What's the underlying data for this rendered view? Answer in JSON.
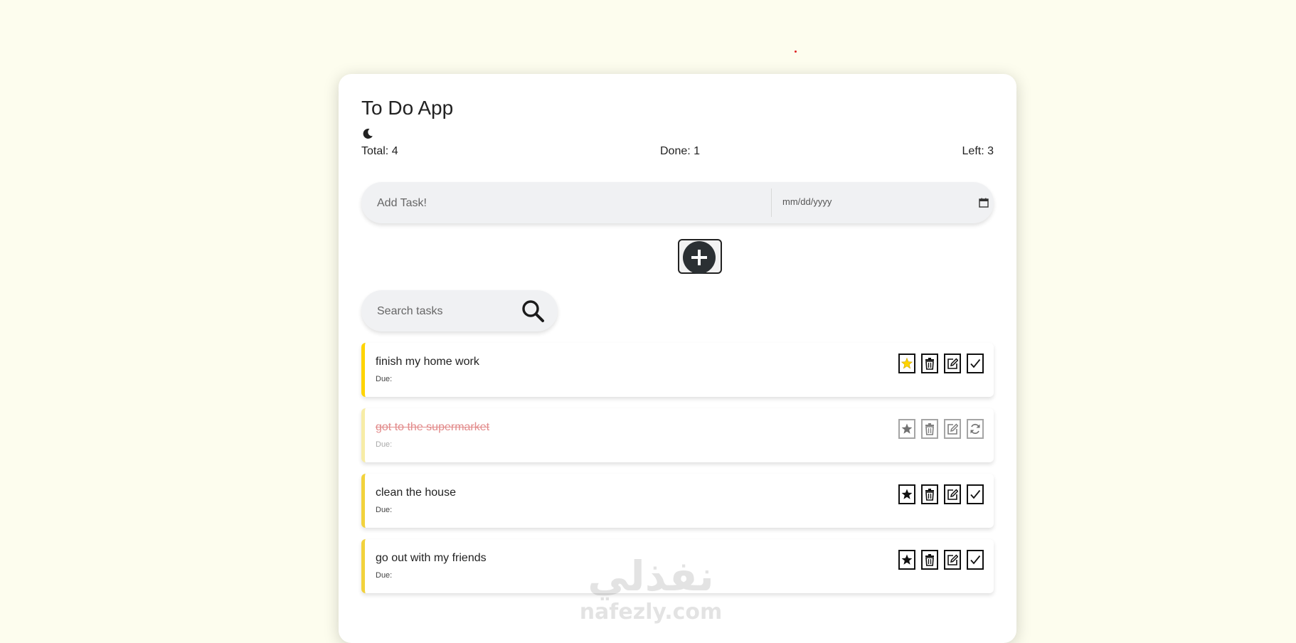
{
  "app": {
    "title": "To Do App",
    "theme_icon": "moon-icon"
  },
  "stats": {
    "total": "Total: 4",
    "done": "Done: 1",
    "left": "Left: 3"
  },
  "add_form": {
    "task_placeholder": "Add Task!",
    "date_placeholder": "mm/dd/yyyy",
    "add_icon": "plus-icon"
  },
  "search": {
    "placeholder": "Search tasks",
    "icon": "search-icon"
  },
  "tasks": [
    {
      "text": "finish my home work",
      "due": "Due:",
      "starred": true,
      "done": false
    },
    {
      "text": "got to the supermarket",
      "due": "Due:",
      "starred": false,
      "done": true
    },
    {
      "text": "clean the house",
      "due": "Due:",
      "starred": false,
      "done": false
    },
    {
      "text": "go out with my friends",
      "due": "Due:",
      "starred": false,
      "done": false
    }
  ],
  "watermark": {
    "arabic": "نفذلي",
    "latin": "nafezly.com"
  },
  "colors": {
    "background": "#fdfdee",
    "accent_yellow": "#f2d23c",
    "star_active": "#ffd400",
    "done_text": "#e28a8a",
    "add_button": "#2b3033"
  }
}
